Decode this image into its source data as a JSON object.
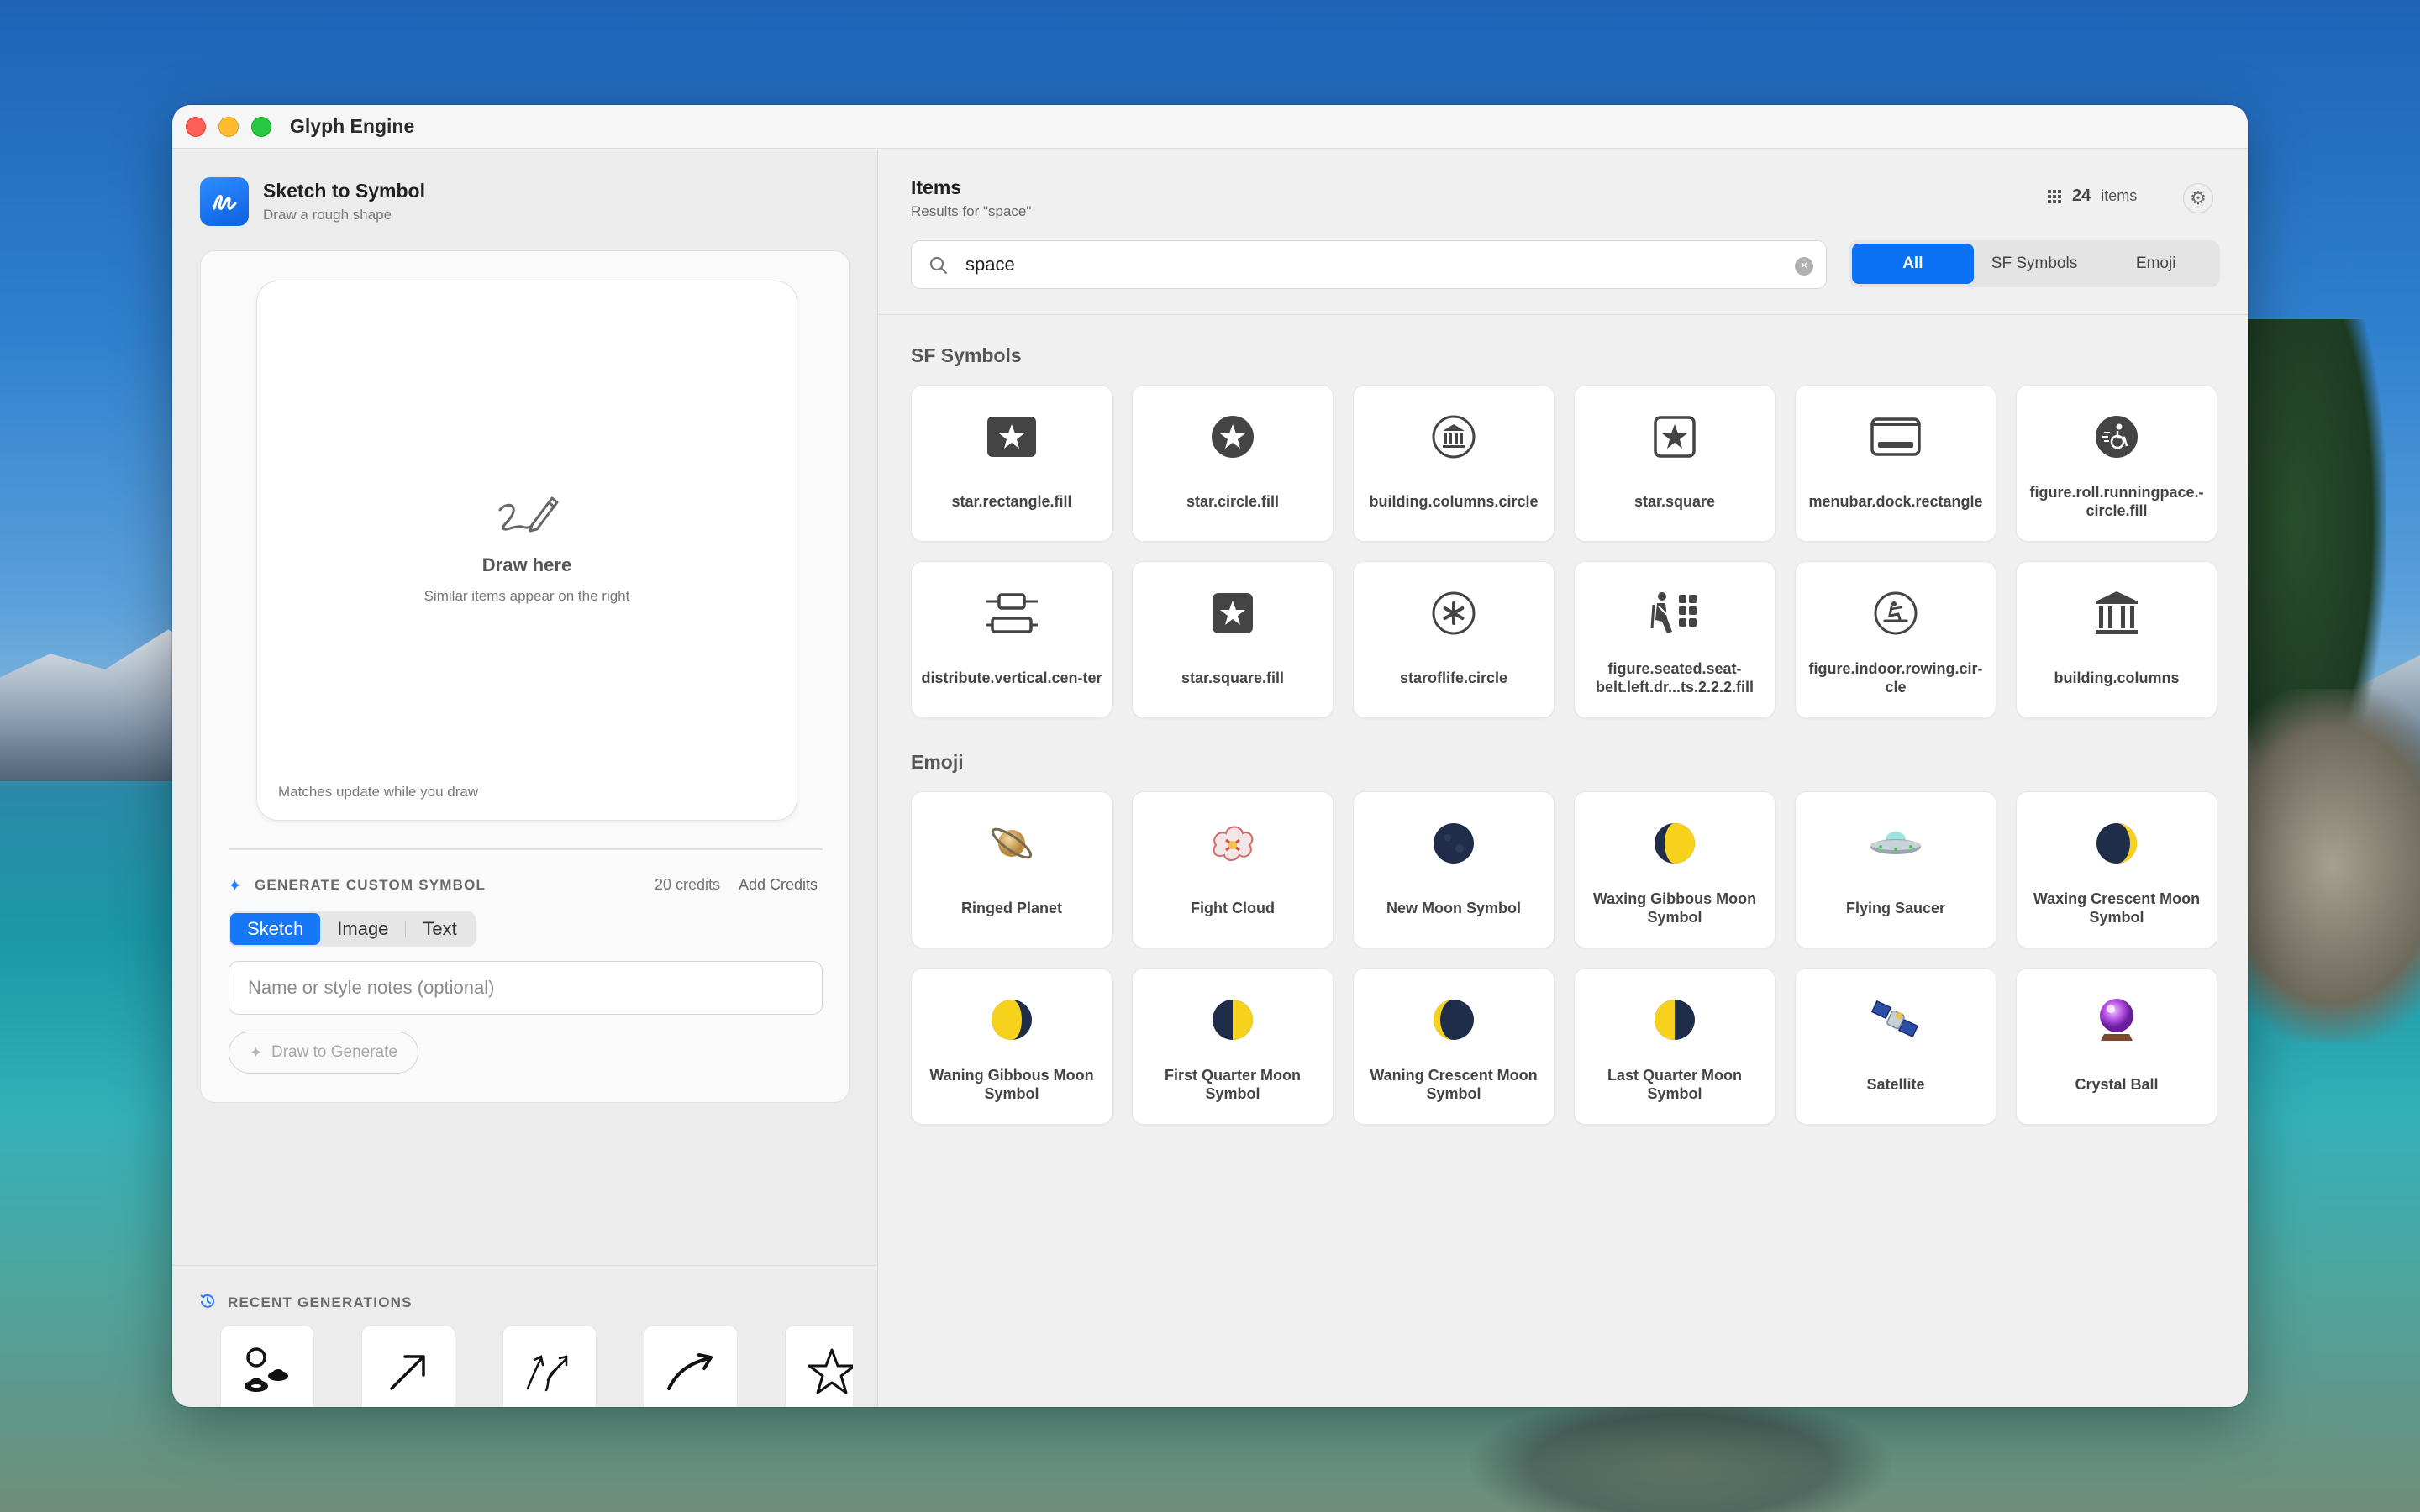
{
  "window": {
    "title": "Glyph Engine"
  },
  "left": {
    "app_title": "Sketch to Symbol",
    "app_subtitle": "Draw a rough shape",
    "canvas": {
      "title": "Draw here",
      "subtitle": "Similar items appear on the right",
      "footer": "Matches update while you draw"
    },
    "generate": {
      "label": "GENERATE CUSTOM SYMBOL",
      "credits": "20 credits",
      "add_credits": "Add Credits",
      "modes": [
        "Sketch",
        "Image",
        "Text"
      ],
      "active_mode": "Sketch",
      "name_placeholder": "Name or style notes (optional)",
      "button": "Draw to Generate"
    },
    "recent": {
      "label": "RECENT GENERATIONS",
      "items": [
        "person-with-saucers-icon",
        "arrow-up-right-icon",
        "double-wavy-arrows-icon",
        "curved-arrow-icon",
        "star-outline-icon"
      ]
    }
  },
  "right": {
    "title": "Items",
    "subtitle": "Results for \"space\"",
    "count": "24",
    "count_label": "items",
    "search_value": "space",
    "filters": [
      "All",
      "SF Symbols",
      "Emoji"
    ],
    "active_filter": "All",
    "sf_section": "SF Symbols",
    "emoji_section": "Emoji",
    "sf_symbols": [
      {
        "name": "star.rectangle.fill",
        "icon": "star-rectangle-fill-icon"
      },
      {
        "name": "star.circle.fill",
        "icon": "star-circle-fill-icon"
      },
      {
        "name": "building.columns.circle",
        "icon": "building-columns-circle-icon"
      },
      {
        "name": "star.square",
        "icon": "star-square-icon"
      },
      {
        "name": "menubar.dock.rectangle",
        "icon": "menubar-dock-rectangle-icon"
      },
      {
        "name": "figure.roll.runningpace.-circle.fill",
        "icon": "figure-roll-runningpace-circle-fill-icon"
      },
      {
        "name": "distribute.vertical.cen-ter",
        "icon": "distribute-vertical-center-icon"
      },
      {
        "name": "star.square.fill",
        "icon": "star-square-fill-icon"
      },
      {
        "name": "staroflife.circle",
        "icon": "staroflife-circle-icon"
      },
      {
        "name": "figure.seated.seat-belt.left.dr...ts.2.2.2.fill",
        "icon": "figure-seated-seatbelt-icon"
      },
      {
        "name": "figure.indoor.rowing.cir-cle",
        "icon": "figure-indoor-rowing-circle-icon"
      },
      {
        "name": "building.columns",
        "icon": "building-columns-icon"
      }
    ],
    "emoji": [
      {
        "name": "Ringed Planet",
        "icon": "ringed-planet-emoji"
      },
      {
        "name": "Fight Cloud",
        "icon": "fight-cloud-emoji"
      },
      {
        "name": "New Moon Symbol",
        "icon": "new-moon-emoji"
      },
      {
        "name": "Waxing Gibbous Moon Symbol",
        "icon": "waxing-gibbous-moon-emoji"
      },
      {
        "name": "Flying Saucer",
        "icon": "flying-saucer-emoji"
      },
      {
        "name": "Waxing Crescent Moon Symbol",
        "icon": "waxing-crescent-moon-emoji"
      },
      {
        "name": "Waning Gibbous Moon Symbol",
        "icon": "waning-gibbous-moon-emoji"
      },
      {
        "name": "First Quarter Moon Symbol",
        "icon": "first-quarter-moon-emoji"
      },
      {
        "name": "Waning Crescent Moon Symbol",
        "icon": "waning-crescent-moon-emoji"
      },
      {
        "name": "Last Quarter Moon Symbol",
        "icon": "last-quarter-moon-emoji"
      },
      {
        "name": "Satellite",
        "icon": "satellite-emoji"
      },
      {
        "name": "Crystal Ball",
        "icon": "crystal-ball-emoji"
      }
    ]
  },
  "colors": {
    "accent": "#0a70f4",
    "window_bg": "#f0f0f0",
    "tile_bg": "#ffffff",
    "moon_dark": "#1f2d4a",
    "moon_light": "#f7d21c"
  }
}
